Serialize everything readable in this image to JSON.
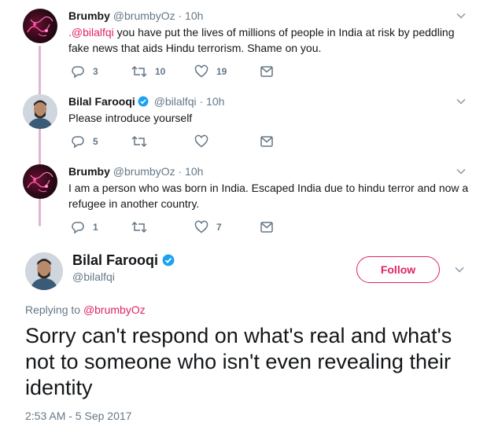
{
  "thread": [
    {
      "name": "Brumby",
      "handle": "@brumbyOz",
      "dot": "·",
      "time": "10h",
      "avatar": "brumby-avatar",
      "verified": false,
      "mention": ".@bilalfqi",
      "text": " you have put the lives of millions of people in India at risk by peddling fake news that aids Hindu terrorism. Shame on you.",
      "replies": "3",
      "retweets": "10",
      "likes": "19"
    },
    {
      "name": "Bilal Farooqi",
      "handle": "@bilalfqi",
      "dot": "·",
      "time": "10h",
      "avatar": "bilal-avatar",
      "verified": true,
      "mention": "",
      "text": "Please introduce yourself",
      "replies": "5",
      "retweets": "",
      "likes": ""
    },
    {
      "name": "Brumby",
      "handle": "@brumbyOz",
      "dot": "·",
      "time": "10h",
      "avatar": "brumby-avatar",
      "verified": false,
      "mention": "",
      "text": "I am a person who was born in India. Escaped India due to hindu terror and now a refugee in another country.",
      "replies": "1",
      "retweets": "",
      "likes": "7"
    }
  ],
  "main": {
    "name": "Bilal Farooqi",
    "handle": "@bilalfqi",
    "follow_label": "Follow",
    "replying_prefix": "Replying to ",
    "replying_to": "@brumbyOz",
    "text": "Sorry can't respond on what's real and what's not to someone who isn't even revealing their identity",
    "timestamp": "2:53 AM - 5 Sep 2017"
  },
  "colors": {
    "accent": "#e0245e",
    "verified": "#1da1f2",
    "muted": "#657786",
    "thread_line": "#e1b6cf"
  },
  "icons": [
    "reply-icon",
    "retweet-icon",
    "like-icon",
    "dm-icon",
    "chevron-down-icon",
    "verified-badge-icon"
  ]
}
